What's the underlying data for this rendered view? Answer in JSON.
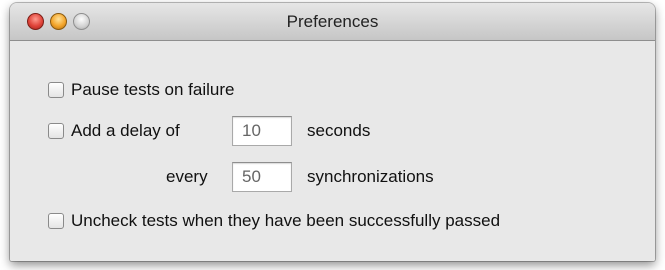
{
  "window": {
    "title": "Preferences"
  },
  "preferences": {
    "pause_on_failure": {
      "label": "Pause tests on failure",
      "checked": false
    },
    "add_delay": {
      "label": "Add a delay of",
      "checked": false,
      "delay_value": "10",
      "delay_unit": "seconds",
      "every_label": "every",
      "every_value": "50",
      "every_unit": "synchronizations"
    },
    "uncheck_passed": {
      "label": "Uncheck tests when they have been successfully passed",
      "checked": false
    }
  }
}
